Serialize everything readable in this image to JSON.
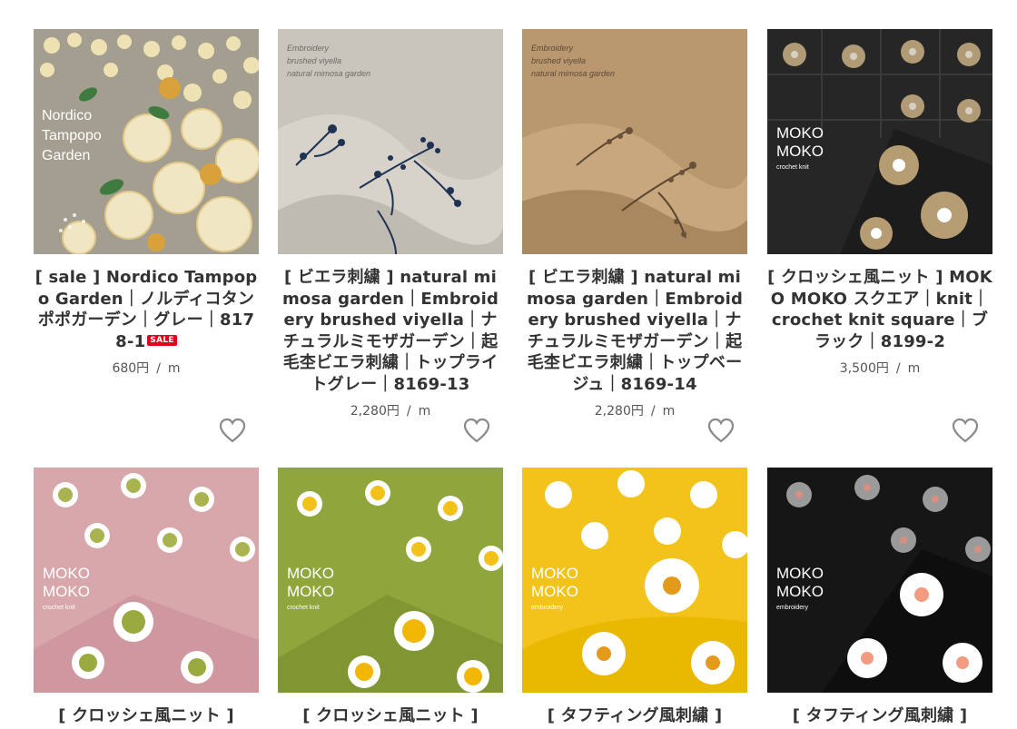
{
  "products": [
    {
      "title": "[ sale ] Nordico Tampopo Garden｜ノルディコタンポポガーデン｜グレー｜8178-1",
      "sale_badge": "SALE",
      "price": "680円",
      "unit": "m",
      "image_overlay": [
        "Nordico",
        "Tampopo",
        "Garden"
      ]
    },
    {
      "title": "[ ビエラ刺繍 ] natural mimosa garden｜Embroidery brushed viyella｜ナチュラルミモザガーデン｜起毛杢ビエラ刺繍｜トップライトグレー｜8169-13",
      "price": "2,280円",
      "unit": "m",
      "image_overlay": [
        "Embroidery",
        "brushed viyella",
        "natural mimosa garden"
      ]
    },
    {
      "title": "[ ビエラ刺繍 ] natural mimosa garden｜Embroidery brushed viyella｜ナチュラルミモザガーデン｜起毛杢ビエラ刺繍｜トップベージュ｜8169-14",
      "price": "2,280円",
      "unit": "m",
      "image_overlay": [
        "Embroidery",
        "brushed viyella",
        "natural mimosa garden"
      ]
    },
    {
      "title": "[ クロッシェ風ニット ] MOKO MOKO スクエア｜knit｜crochet knit square｜ブラック｜8199-2",
      "price": "3,500円",
      "unit": "m",
      "image_overlay": [
        "MOKO",
        "MOKO",
        "crochet knit"
      ]
    },
    {
      "title": "[ クロッシェ風ニット ]",
      "image_overlay": [
        "MOKO",
        "MOKO",
        "crochet knit"
      ]
    },
    {
      "title": "[ クロッシェ風ニット ]",
      "image_overlay": [
        "MOKO",
        "MOKO",
        "crochet knit"
      ]
    },
    {
      "title": "[ タフティング風刺繍 ]",
      "image_overlay": [
        "MOKO",
        "MOKO",
        "embroidery"
      ]
    },
    {
      "title": "[ タフティング風刺繍 ]",
      "image_overlay": [
        "MOKO",
        "MOKO",
        "embroidery"
      ]
    }
  ],
  "colors": {
    "heart_outline": "#8a8a8a",
    "sale_badge": "#e0001b",
    "title_text": "#333333"
  },
  "icons": {
    "favorite": "heart-outline-icon"
  }
}
